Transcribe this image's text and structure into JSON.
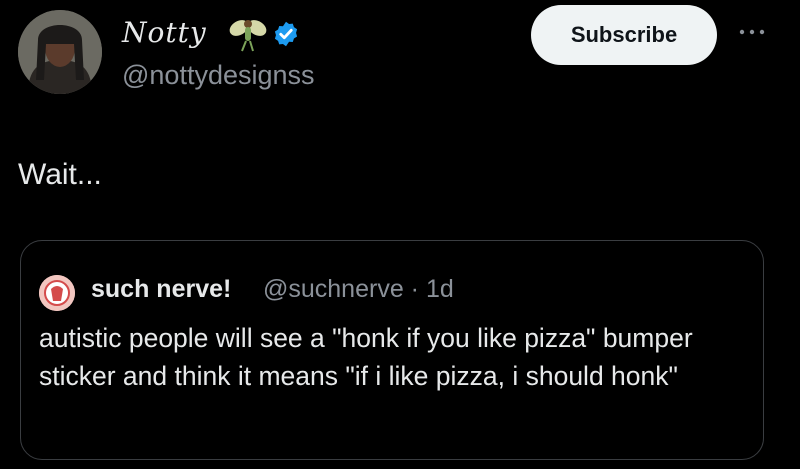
{
  "author": {
    "display_name": "Notty",
    "handle": "@nottydesignss",
    "name_emoji": "fairy-icon",
    "verified": true
  },
  "header": {
    "subscribe_label": "Subscribe"
  },
  "tweet": {
    "text": "Wait..."
  },
  "quoted_tweet": {
    "display_name": "such nerve!",
    "handle_time": "@suchnerve · 1d",
    "text": "autistic people will see a \"honk if you like pizza\" bumper sticker and think it means \"if i like pizza, i should honk\""
  },
  "colors": {
    "background": "#000000",
    "text": "#e7e9ea",
    "secondary_text": "#8b9199",
    "verified_blue": "#1d9bf0",
    "subscribe_bg": "#eff3f4",
    "border": "#3a3d41"
  }
}
